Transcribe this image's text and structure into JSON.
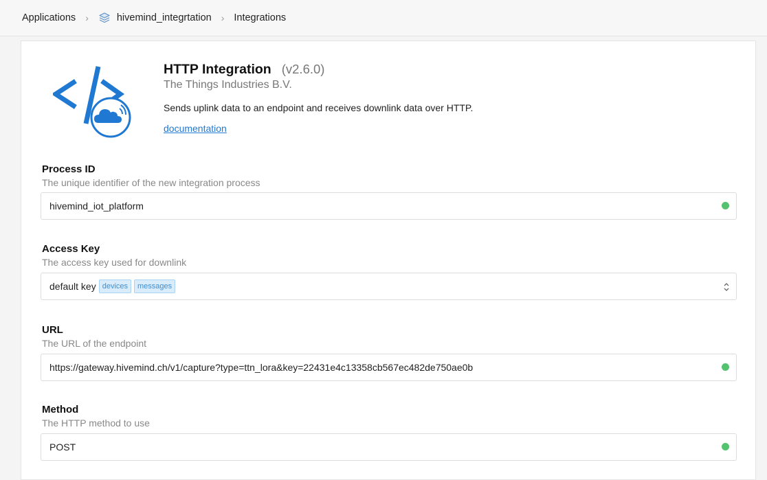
{
  "breadcrumb": {
    "items": [
      "Applications",
      "hivemind_integrtation",
      "Integrations"
    ],
    "separator": ">"
  },
  "integration": {
    "title": "HTTP Integration",
    "version": "(v2.6.0)",
    "company": "The Things Industries B.V.",
    "description": "Sends uplink data to an endpoint and receives downlink data over HTTP.",
    "documentation_link": "documentation",
    "logo_icon": "http-integration-logo"
  },
  "fields": {
    "process_id": {
      "label": "Process ID",
      "help": "The unique identifier of the new integration process",
      "value": "hivemind_iot_platform",
      "valid": true
    },
    "access_key": {
      "label": "Access Key",
      "help": "The access key used for downlink",
      "value": "default key",
      "tags": [
        "devices",
        "messages"
      ]
    },
    "url": {
      "label": "URL",
      "help": "The URL of the endpoint",
      "value": "https://gateway.hivemind.ch/v1/capture?type=ttn_lora&key=22431e4c13358cb567ec482de750ae0b",
      "valid": true
    },
    "method": {
      "label": "Method",
      "help": "The HTTP method to use",
      "value": "POST",
      "valid": true
    }
  },
  "colors": {
    "accent": "#1f78d1",
    "valid": "#54c26e",
    "tag_bg": "#d9ecfb",
    "tag_text": "#3a8fd4"
  }
}
